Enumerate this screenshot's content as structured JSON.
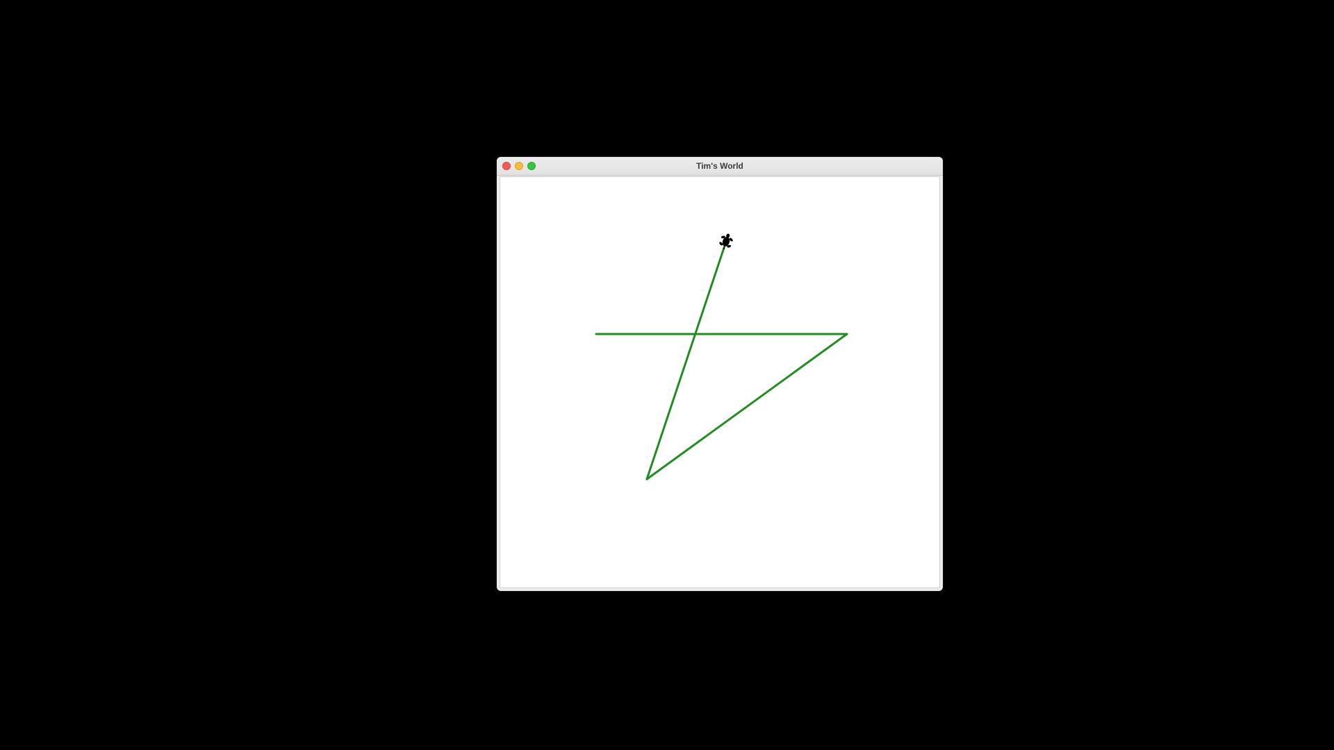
{
  "window": {
    "title": "Tim's World"
  },
  "colors": {
    "pen": "#228b22",
    "turtle": "#000000",
    "background": "#ffffff",
    "desktop": "#000000"
  },
  "turtle": {
    "shape": "turtle",
    "icon": "turtle-icon"
  }
}
